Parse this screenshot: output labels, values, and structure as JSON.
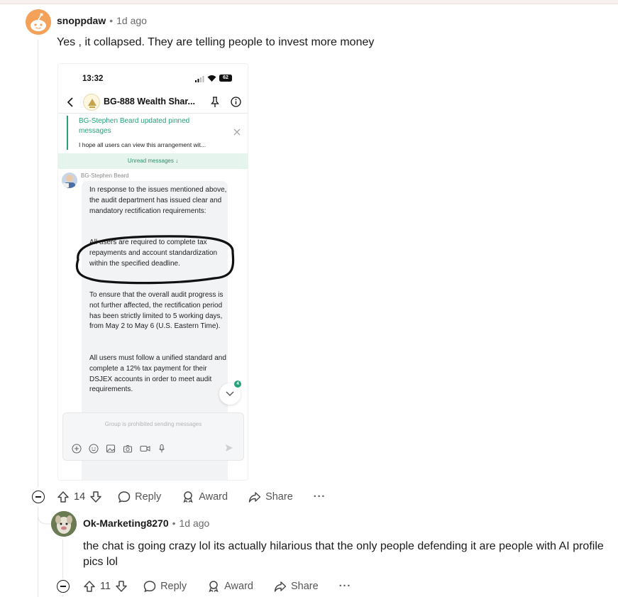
{
  "comment1": {
    "author": "snoppdaw",
    "time": "1d ago",
    "text": "Yes , it collapsed. They are telling people to invest more money",
    "votes": "14",
    "reply_label": "Reply",
    "award_label": "Award",
    "share_label": "Share",
    "more_label": "···"
  },
  "phone": {
    "time": "13:32",
    "battery": "62",
    "group_title": "BG-888 Wealth Shar...",
    "pinned_title": "BG-Stephen Beard updated pinned messages",
    "pinned_preview": "I hope all users can view this arrangement wit...",
    "unread": "Unread messages ↓",
    "sender": "BG-Stephen Beard",
    "msg1": "In response to the issues mentioned above, the audit department has issued clear and mandatory rectification requirements:",
    "msg2": "All users are required to complete tax repayments and account standardization within the specified deadline.",
    "msg3": "To ensure that the overall audit progress is not further affected, the rectification period has been strictly limited to 5 working days, from May 2 to May 6 (U.S. Eastern Time).",
    "msg4": "All users must follow a unified standard and complete a 12% tax payment for their DSJEX accounts in order to meet audit requirements.",
    "input_placeholder": "Group is prohibited sending messages",
    "scroll_badge": "4"
  },
  "comment2": {
    "author": "Ok-Marketing8270",
    "time": "1d ago",
    "text_line1": "the chat is going crazy lol its actually hilarious that the only people defending it are people with AI profile",
    "text_line2": "pics lol",
    "votes": "11",
    "reply_label": "Reply",
    "award_label": "Award",
    "share_label": "Share",
    "more_label": "···"
  },
  "colors": {
    "accent_green": "#26a17b",
    "avatar_orange": "#f4a25a"
  },
  "icons": [
    "collapse-icon",
    "upvote-icon",
    "downvote-icon",
    "comment-icon",
    "award-icon",
    "share-icon",
    "more-icon"
  ]
}
